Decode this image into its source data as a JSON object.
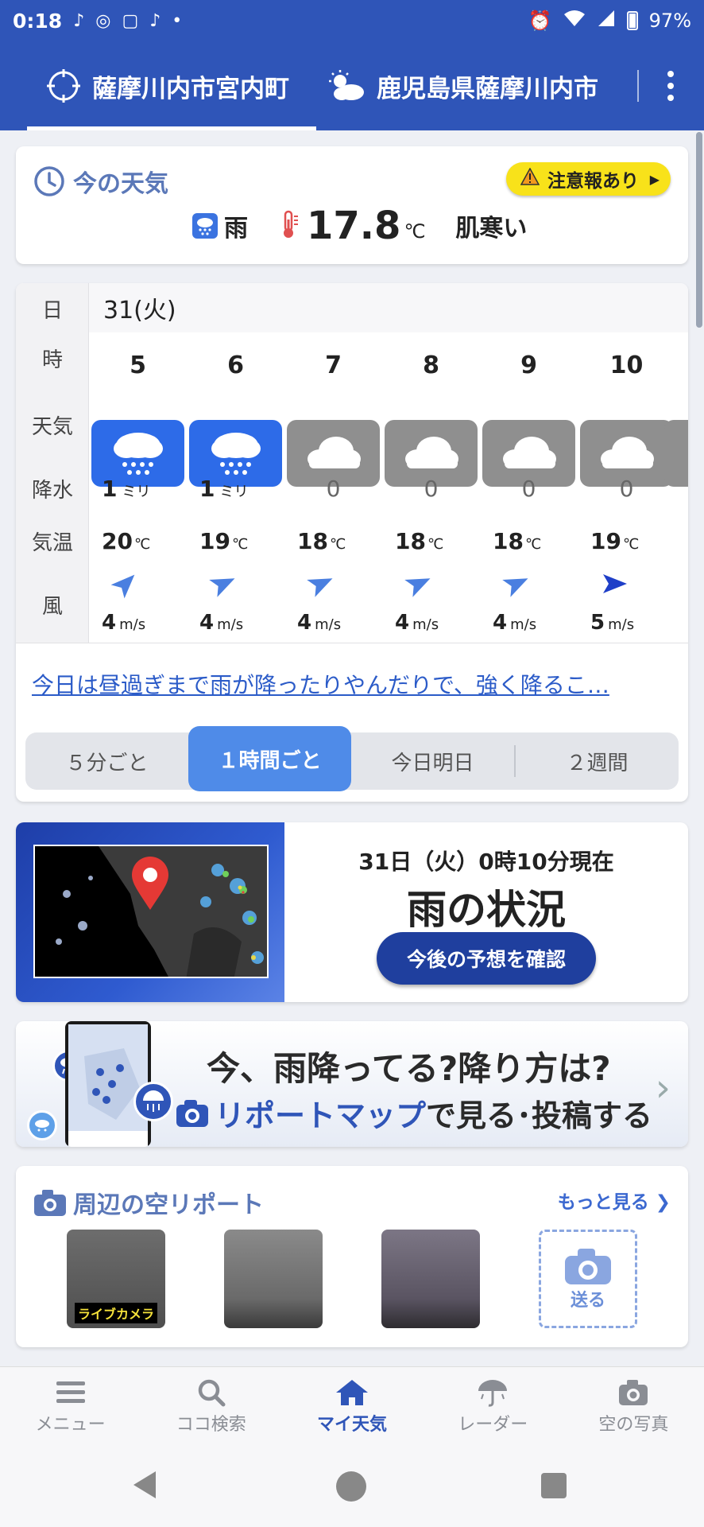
{
  "status_bar": {
    "time": "0:18",
    "battery": "97%"
  },
  "tabs": [
    {
      "label": "薩摩川内市宮内町",
      "active": true,
      "icon": "location-target-icon"
    },
    {
      "label": "鹿児島県薩摩川内市",
      "active": false,
      "icon": "cloud-sun-icon"
    }
  ],
  "now": {
    "title": "今の天気",
    "alert": "注意報あり",
    "condition": "雨",
    "temp": "17.8",
    "temp_unit": "℃",
    "feel": "肌寒い"
  },
  "hourly": {
    "row_labels": {
      "date": "日",
      "hour": "時",
      "weather": "天気",
      "precip": "降水",
      "temp": "気温",
      "wind": "風"
    },
    "date": "31(火)",
    "hours": [
      {
        "hour": "5",
        "weather": "rain",
        "precip": "1",
        "precip_unit": "ミリ",
        "temp": "20",
        "wind": "4",
        "wind_dir_deg": 45,
        "wind_color": "#4a7fe0"
      },
      {
        "hour": "6",
        "weather": "rain",
        "precip": "1",
        "precip_unit": "ミリ",
        "temp": "19",
        "wind": "4",
        "wind_dir_deg": 65,
        "wind_color": "#4a7fe0"
      },
      {
        "hour": "7",
        "weather": "cloud",
        "precip": "0",
        "precip_unit": "",
        "temp": "18",
        "wind": "4",
        "wind_dir_deg": 65,
        "wind_color": "#4a7fe0"
      },
      {
        "hour": "8",
        "weather": "cloud",
        "precip": "0",
        "precip_unit": "",
        "temp": "18",
        "wind": "4",
        "wind_dir_deg": 65,
        "wind_color": "#4a7fe0"
      },
      {
        "hour": "9",
        "weather": "cloud",
        "precip": "0",
        "precip_unit": "",
        "temp": "18",
        "wind": "4",
        "wind_dir_deg": 65,
        "wind_color": "#4a7fe0"
      },
      {
        "hour": "10",
        "weather": "cloud",
        "precip": "0",
        "precip_unit": "",
        "temp": "19",
        "wind": "5",
        "wind_dir_deg": 90,
        "wind_color": "#1f3fc8"
      }
    ],
    "temp_unit": "℃",
    "wind_unit": "m/s",
    "comment": "今日は昼過ぎまで雨が降ったりやんだりで、強く降るこ…",
    "segments": [
      "５分ごと",
      "１時間ごと",
      "今日明日",
      "２週間"
    ],
    "active_segment": 1
  },
  "radar": {
    "time": "31日（火）0時10分現在",
    "headline": "雨の状況",
    "button": "今後の予想を確認"
  },
  "banner": {
    "line1": "今、雨降ってる?降り方は?",
    "line2_blue": "リポートマップ",
    "line2_rest": "で見る･投稿する"
  },
  "sky_report": {
    "title": "周辺の空リポート",
    "more": "もっと見る",
    "live_label": "ライブカメラ",
    "send": "送る"
  },
  "bottom_nav": [
    {
      "label": "メニュー",
      "icon": "menu-icon",
      "active": false
    },
    {
      "label": "ココ検索",
      "icon": "search-icon",
      "active": false
    },
    {
      "label": "マイ天気",
      "icon": "home-icon",
      "active": true
    },
    {
      "label": "レーダー",
      "icon": "radar-umbrella-icon",
      "active": false
    },
    {
      "label": "空の写真",
      "icon": "camera-icon",
      "active": false
    }
  ],
  "colors": {
    "brand": "#2f55b8",
    "rain_box": "#2d6be8",
    "cloud_box": "#8f8f8f",
    "alert": "#f8e21a",
    "link": "#2b5bc8"
  }
}
